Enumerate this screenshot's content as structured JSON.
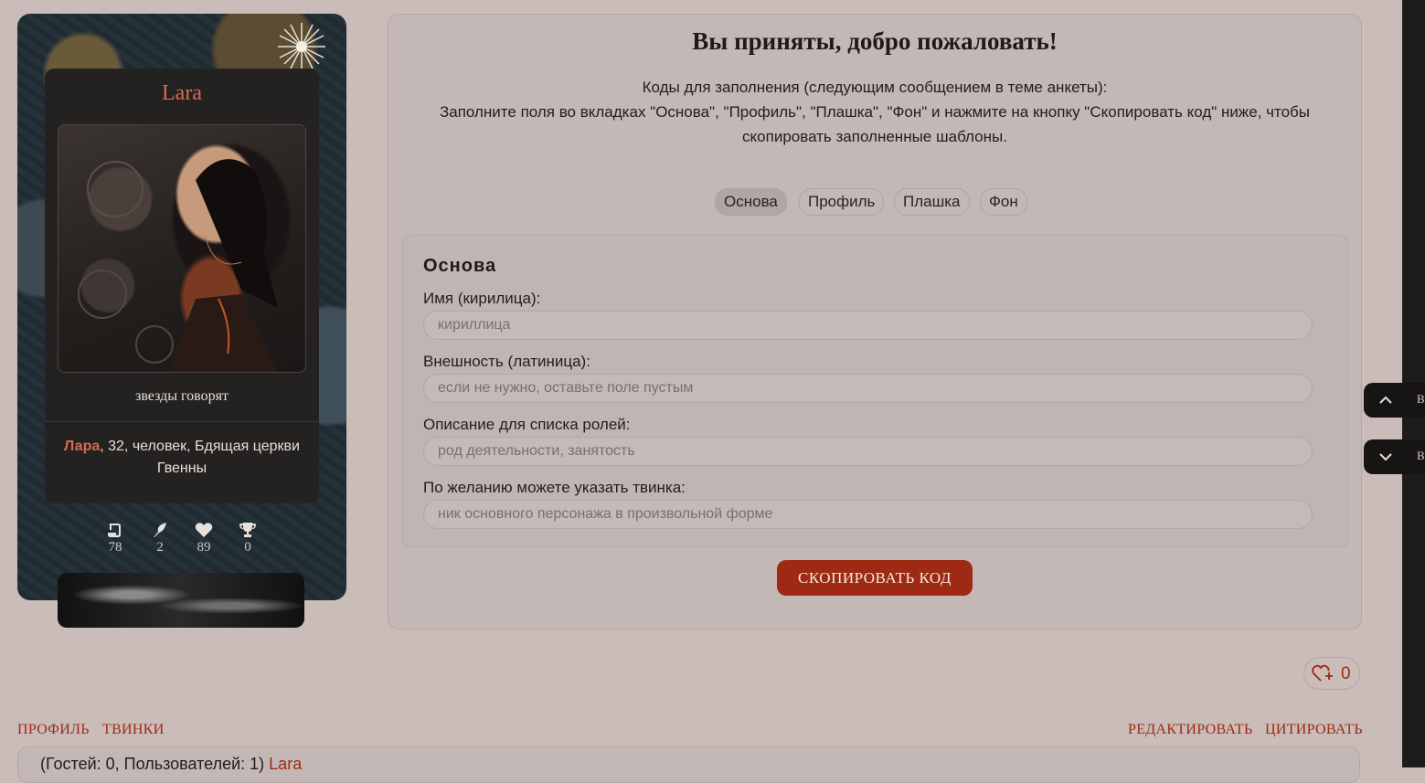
{
  "profile": {
    "name": "Lara",
    "status": "звезды говорят",
    "info_name": "Лара",
    "info_rest": ", 32, человек, Бдящая церкви Гвенны",
    "stats": [
      {
        "icon": "scroll-icon",
        "value": "78"
      },
      {
        "icon": "quill-icon",
        "value": "2"
      },
      {
        "icon": "heart-icon",
        "value": "89"
      },
      {
        "icon": "trophy-icon",
        "value": "0"
      }
    ]
  },
  "post": {
    "title": "Вы приняты, добро пожаловать!",
    "intro_line1": "Коды для заполнения (следующим сообщением в теме анкеты):",
    "intro_line2": "Заполните поля во вкладках \"Основа\", \"Профиль\", \"Плашка\", \"Фон\" и нажмите на кнопку \"Скопировать код\" ниже, чтобы скопировать заполненные шаблоны.",
    "tabs": [
      "Основа",
      "Профиль",
      "Плашка",
      "Фон"
    ],
    "active_tab": "Основа",
    "section_title": "Основа",
    "fields": [
      {
        "label": "Имя (кирилица):",
        "placeholder": "кириллица"
      },
      {
        "label": "Внешность (латиница):",
        "placeholder": "если не нужно, оставьте поле пустым"
      },
      {
        "label": "Описание для списка ролей:",
        "placeholder": "род деятельности, занятость"
      },
      {
        "label": "По желанию можете указать твинка:",
        "placeholder": "ник основного персонажа в произвольной форме"
      }
    ],
    "copy_button": "СКОПИРОВАТЬ КОД"
  },
  "side_nav": {
    "up_label": "В",
    "down_label": "В"
  },
  "like": {
    "count": "0"
  },
  "footer": {
    "links_left": [
      "ПРОФИЛЬ",
      "ТВИНКИ"
    ],
    "links_right": [
      "РЕДАКТИРОВАТЬ",
      "ЦИТИРОВАТЬ"
    ],
    "online_prefix": "(Гостей: 0, Пользователей: 1) ",
    "online_user": "Lara"
  },
  "colors": {
    "accent": "#9e2a13",
    "name_accent": "#d66a4f",
    "background": "#c9bcb9",
    "card": "#242221"
  }
}
